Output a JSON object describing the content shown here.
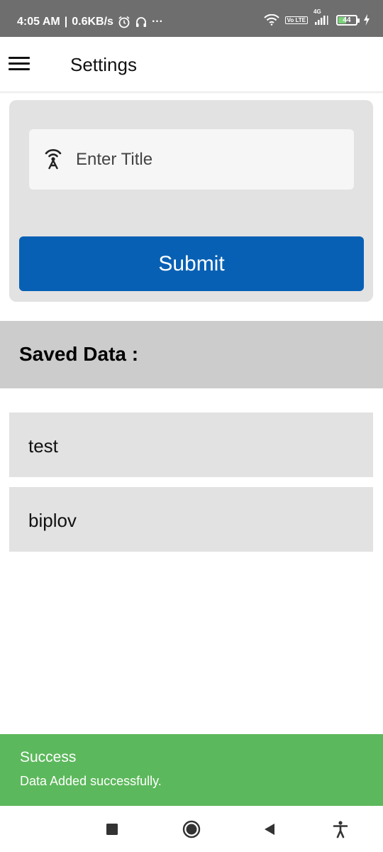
{
  "status_bar": {
    "time": "4:05 AM",
    "separator": "|",
    "speed": "0.6KB/s",
    "more": "···",
    "network": "4G",
    "volte": "Vo LTE",
    "battery": "44",
    "icons": [
      "alarm-icon",
      "headphones-icon",
      "wifi-icon",
      "signal-icon",
      "battery-icon",
      "charging-icon"
    ]
  },
  "app_bar": {
    "title": "Settings",
    "menu_icon": "hamburger-menu-icon"
  },
  "form": {
    "input_placeholder": "Enter Title",
    "input_value": "",
    "input_icon": "antenna-icon",
    "submit_label": "Submit"
  },
  "saved": {
    "heading": "Saved Data :",
    "items": [
      {
        "label": "test"
      },
      {
        "label": "biplov"
      }
    ]
  },
  "toast": {
    "title": "Success",
    "message": "Data Added successfully.",
    "color": "#5cb85c"
  },
  "nav_bar": {
    "buttons": [
      "recents-square-icon",
      "home-circle-icon",
      "back-triangle-icon",
      "accessibility-icon"
    ]
  },
  "colors": {
    "status_bar": "#6e6e6e",
    "primary_button": "#0760b4",
    "card_bg": "#e2e2e2",
    "header_bg": "#cccccc"
  }
}
